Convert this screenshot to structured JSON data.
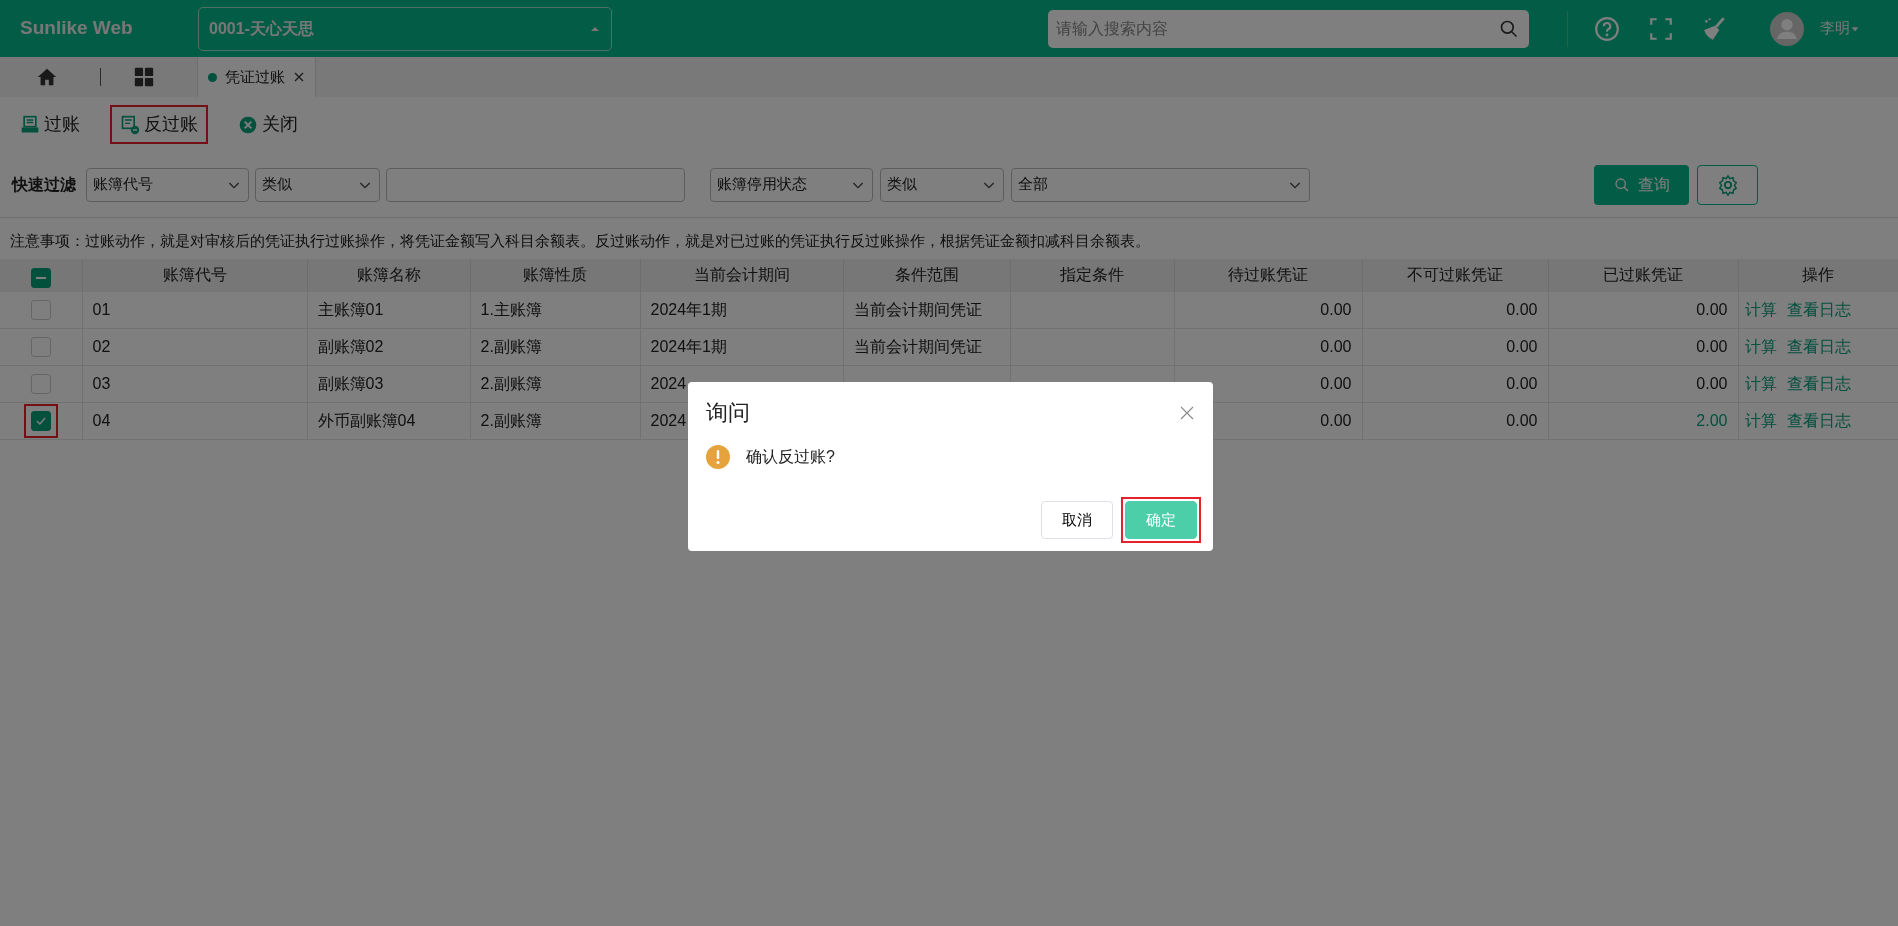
{
  "header": {
    "logo": "Sunlike Web",
    "company": "0001-天心天思",
    "search_placeholder": "请输入搜索内容",
    "user": "李明"
  },
  "tabs": [
    {
      "label": "凭证过账",
      "selected": true
    }
  ],
  "toolbar": [
    {
      "kind": "post",
      "label": "过账",
      "highlighted": false
    },
    {
      "kind": "unpost",
      "label": "反过账",
      "highlighted": true
    },
    {
      "kind": "close",
      "label": "关闭",
      "highlighted": false
    }
  ],
  "filter": {
    "label": "快速过滤",
    "fields": [
      {
        "kind": "select",
        "value": "账簿代号"
      },
      {
        "kind": "select",
        "value": "类似"
      },
      {
        "kind": "text"
      },
      {
        "kind": "select",
        "value": "账簿停用状态"
      },
      {
        "kind": "select",
        "value": "类似"
      },
      {
        "kind": "select",
        "value": "全部"
      }
    ],
    "query_button": "查询"
  },
  "notice": "注意事项：过账动作，就是对审核后的凭证执行过账操作，将凭证金额写入科目余额表。反过账动作，就是对已过账的凭证执行反过账操作，根据凭证金额扣减科目余额表。",
  "table": {
    "select_all": {
      "indeterminate": true
    },
    "columns": [
      "账簿代号",
      "账簿名称",
      "账簿性质",
      "当前会计期间",
      "条件范围",
      "指定条件",
      "待过账凭证",
      "不可过账凭证",
      "已过账凭证",
      "操作"
    ],
    "rows": [
      {
        "selected": false,
        "highlighted": false,
        "cells": [
          "01",
          "主账簿01",
          "1.主账簿",
          "2024年1期",
          "当前会计期间凭证",
          "",
          "0.00",
          "0.00",
          "0.00"
        ],
        "posted_emphasis": false,
        "actions": [
          "计算",
          "查看日志"
        ]
      },
      {
        "selected": false,
        "highlighted": false,
        "cells": [
          "02",
          "副账簿02",
          "2.副账簿",
          "2024年1期",
          "当前会计期间凭证",
          "",
          "0.00",
          "0.00",
          "0.00"
        ],
        "posted_emphasis": false,
        "actions": [
          "计算",
          "查看日志"
        ]
      },
      {
        "selected": false,
        "highlighted": false,
        "cells": [
          "03",
          "副账簿03",
          "2.副账簿",
          "2024",
          "",
          "",
          "0.00",
          "0.00",
          "0.00"
        ],
        "posted_emphasis": false,
        "actions": [
          "计算",
          "查看日志"
        ]
      },
      {
        "selected": true,
        "highlighted": true,
        "cells": [
          "04",
          "外币副账簿04",
          "2.副账簿",
          "2024",
          "",
          "",
          "0.00",
          "0.00",
          "2.00"
        ],
        "posted_emphasis": true,
        "actions": [
          "计算",
          "查看日志"
        ]
      }
    ]
  },
  "dialog": {
    "title": "询问",
    "message": "确认反过账?",
    "buttons": [
      {
        "kind": "secondary",
        "label": "取消",
        "highlighted": false
      },
      {
        "kind": "primary",
        "label": "确定",
        "highlighted": true
      }
    ]
  }
}
